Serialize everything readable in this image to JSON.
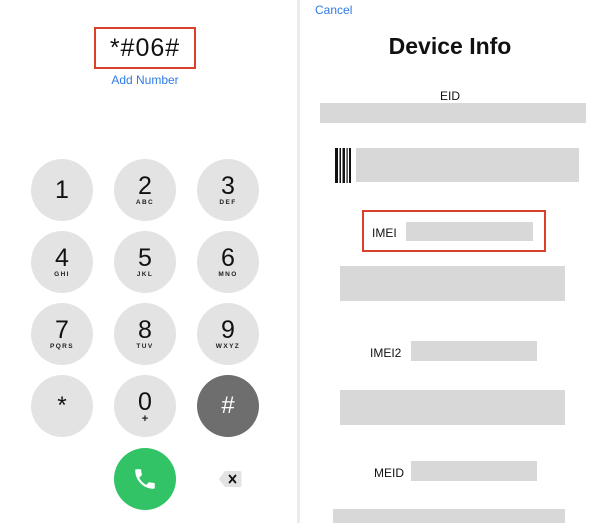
{
  "dialer": {
    "dialed_number": "*#06#",
    "add_number_label": "Add Number",
    "keys": [
      {
        "digit": "1",
        "letters": ""
      },
      {
        "digit": "2",
        "letters": "ABC"
      },
      {
        "digit": "3",
        "letters": "DEF"
      },
      {
        "digit": "4",
        "letters": "GHI"
      },
      {
        "digit": "5",
        "letters": "JKL"
      },
      {
        "digit": "6",
        "letters": "MNO"
      },
      {
        "digit": "7",
        "letters": "PQRS"
      },
      {
        "digit": "8",
        "letters": "TUV"
      },
      {
        "digit": "9",
        "letters": "WXYZ"
      },
      {
        "digit": "*",
        "letters": ""
      },
      {
        "digit": "0",
        "letters": "+"
      },
      {
        "digit": "#",
        "letters": ""
      }
    ],
    "call_icon": "phone-icon",
    "delete_icon": "backspace-icon"
  },
  "device_info": {
    "cancel_label": "Cancel",
    "title": "Device Info",
    "eid_label": "EID",
    "imei_label": "IMEI",
    "imei2_label": "IMEI2",
    "meid_label": "MEID",
    "barcode_icon": "barcode-icon"
  },
  "colors": {
    "highlight": "#d9412b",
    "link": "#2f7be6",
    "key_bg": "#e3e3e3",
    "hash_key_bg": "#6e6e6e",
    "call_green": "#32c366",
    "redaction_gray": "#d8d8d8"
  }
}
